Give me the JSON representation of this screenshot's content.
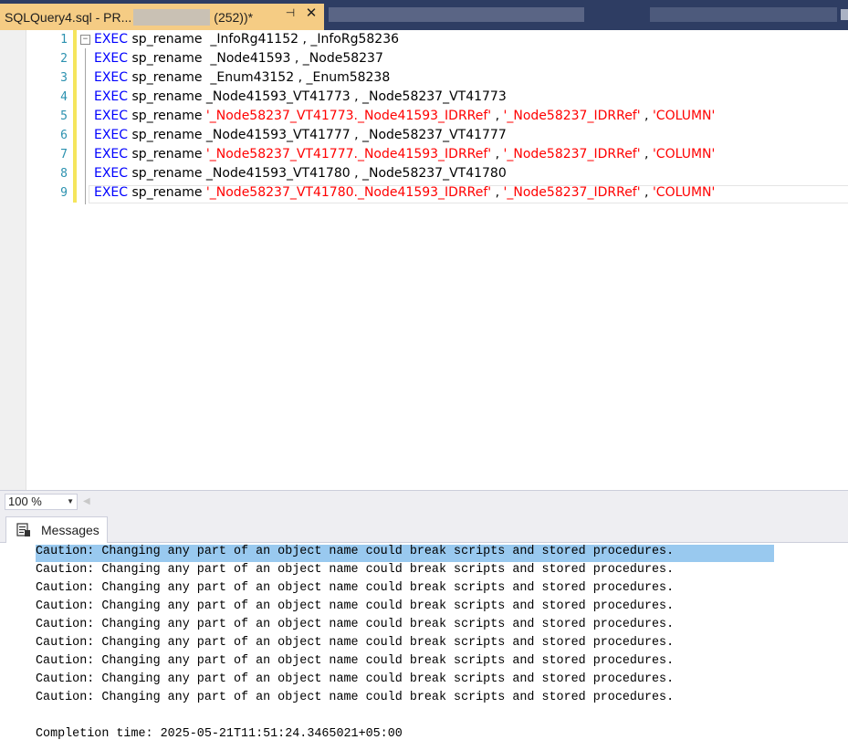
{
  "tab": {
    "title_prefix": "SQLQuery4.sql - PR...",
    "title_suffix": "(252))*",
    "pin_glyph": "⊣",
    "close_glyph": "✕"
  },
  "editor": {
    "line_numbers": [
      "1",
      "2",
      "3",
      "4",
      "5",
      "6",
      "7",
      "8",
      "9"
    ],
    "lines": [
      [
        {
          "t": "EXEC",
          "c": "kw"
        },
        {
          "t": " sp_rename  _InfoRg41152 , _InfoRg58236",
          "c": ""
        }
      ],
      [
        {
          "t": "EXEC",
          "c": "kw"
        },
        {
          "t": " sp_rename  _Node41593 , _Node58237",
          "c": ""
        }
      ],
      [
        {
          "t": "EXEC",
          "c": "kw"
        },
        {
          "t": " sp_rename  _Enum43152 , _Enum58238",
          "c": ""
        }
      ],
      [
        {
          "t": "EXEC",
          "c": "kw"
        },
        {
          "t": " sp_rename _Node41593_VT41773 , _Node58237_VT41773",
          "c": ""
        }
      ],
      [
        {
          "t": "EXEC",
          "c": "kw"
        },
        {
          "t": " sp_rename ",
          "c": ""
        },
        {
          "t": "'_Node58237_VT41773._Node41593_IDRRef'",
          "c": "str"
        },
        {
          "t": " , ",
          "c": ""
        },
        {
          "t": "'_Node58237_IDRRef'",
          "c": "str"
        },
        {
          "t": " , ",
          "c": ""
        },
        {
          "t": "'COLUMN'",
          "c": "str"
        }
      ],
      [
        {
          "t": "EXEC",
          "c": "kw"
        },
        {
          "t": " sp_rename _Node41593_VT41777 , _Node58237_VT41777",
          "c": ""
        }
      ],
      [
        {
          "t": "EXEC",
          "c": "kw"
        },
        {
          "t": " sp_rename ",
          "c": ""
        },
        {
          "t": "'_Node58237_VT41777._Node41593_IDRRef'",
          "c": "str"
        },
        {
          "t": " , ",
          "c": ""
        },
        {
          "t": "'_Node58237_IDRRef'",
          "c": "str"
        },
        {
          "t": " , ",
          "c": ""
        },
        {
          "t": "'COLUMN'",
          "c": "str"
        }
      ],
      [
        {
          "t": "EXEC",
          "c": "kw"
        },
        {
          "t": " sp_rename _Node41593_VT41780 , _Node58237_VT41780",
          "c": ""
        }
      ],
      [
        {
          "t": "EXEC",
          "c": "kw"
        },
        {
          "t": " sp_rename ",
          "c": ""
        },
        {
          "t": "'_Node58237_VT41780._Node41593_IDRRef'",
          "c": "str"
        },
        {
          "t": " , ",
          "c": ""
        },
        {
          "t": "'_Node58237_IDRRef'",
          "c": "str"
        },
        {
          "t": " , ",
          "c": ""
        },
        {
          "t": "'COLUMN'",
          "c": "str"
        }
      ]
    ]
  },
  "zoom": {
    "value": "100 %"
  },
  "results": {
    "tab_label": "Messages",
    "messages": [
      "Caution: Changing any part of an object name could break scripts and stored procedures.",
      "Caution: Changing any part of an object name could break scripts and stored procedures.",
      "Caution: Changing any part of an object name could break scripts and stored procedures.",
      "Caution: Changing any part of an object name could break scripts and stored procedures.",
      "Caution: Changing any part of an object name could break scripts and stored procedures.",
      "Caution: Changing any part of an object name could break scripts and stored procedures.",
      "Caution: Changing any part of an object name could break scripts and stored procedures.",
      "Caution: Changing any part of an object name could break scripts and stored procedures.",
      "Caution: Changing any part of an object name could break scripts and stored procedures."
    ],
    "completion": "Completion time: 2025-05-21T11:51:24.3465021+05:00"
  },
  "colors": {
    "keyword": "#0000ff",
    "string": "#ff0000",
    "active_tab": "#f5cc84",
    "tabbar": "#2e3d63",
    "selection": "#99c9ef",
    "line_number": "#2b91af",
    "change_marker": "#f5e55c"
  }
}
